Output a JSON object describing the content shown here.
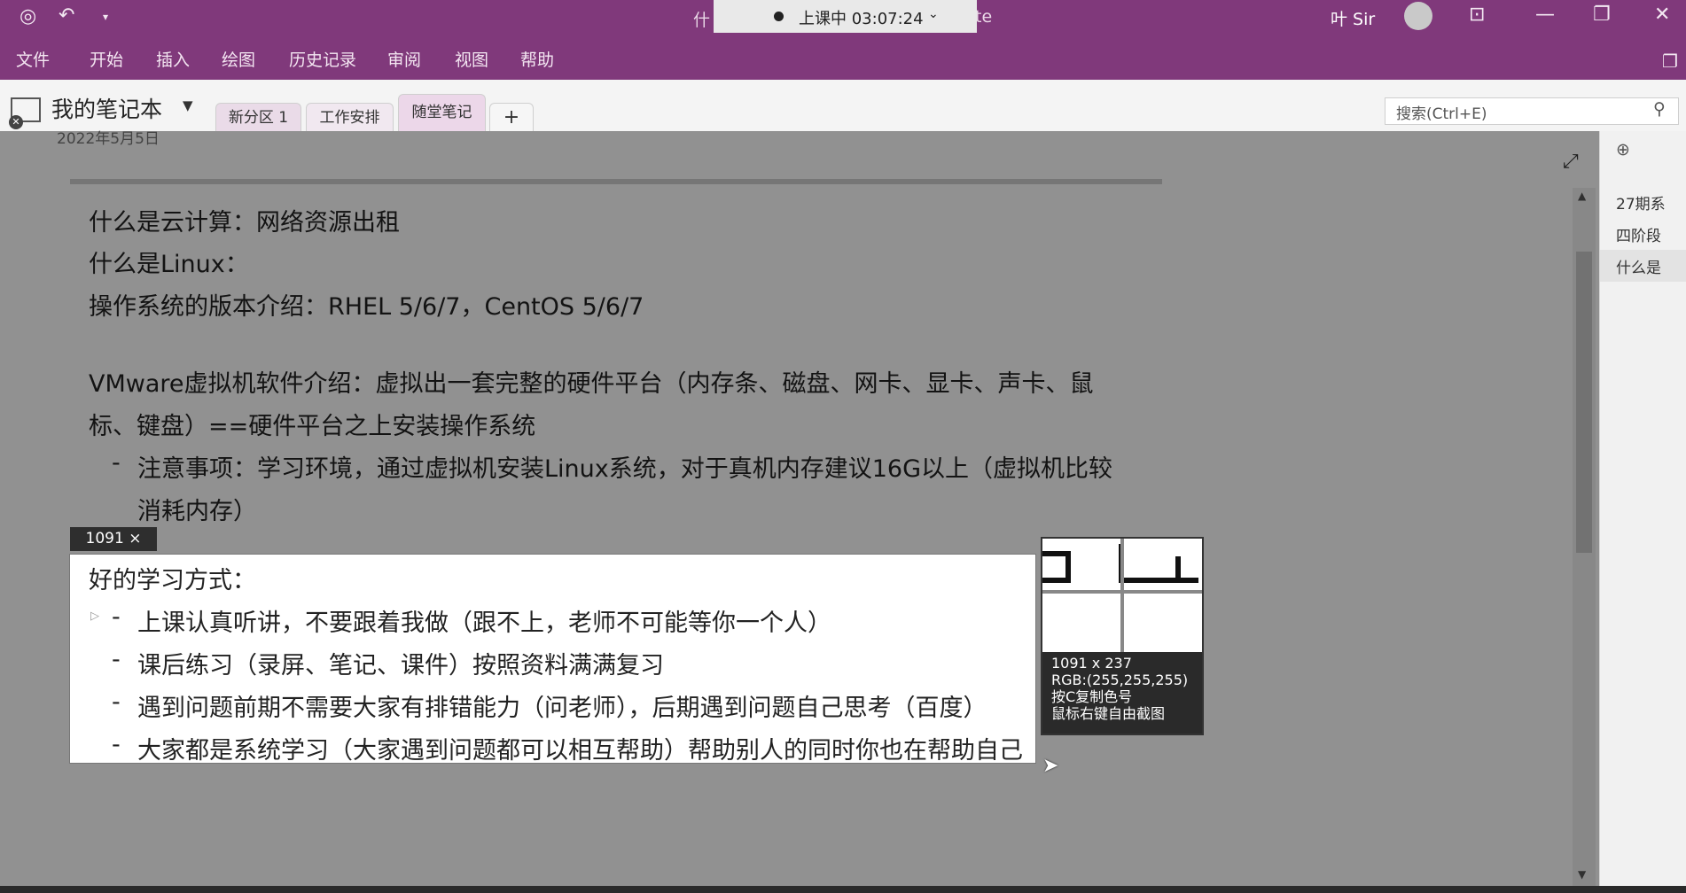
{
  "title_bar": {
    "title_left": "什",
    "title_right": "te",
    "recording": "上课中 03:07:24",
    "user": "叶 Sir"
  },
  "ribbon": {
    "tabs": [
      "文件",
      "开始",
      "插入",
      "绘图",
      "历史记录",
      "审阅",
      "视图",
      "帮助"
    ]
  },
  "notebook": {
    "name": "我的笔记本",
    "sections": [
      "新分区 1",
      "工作安排",
      "随堂笔记"
    ],
    "add_tab": "+",
    "search_placeholder": "搜索(Ctrl+E)"
  },
  "page": {
    "date_fragment": "2022年5月5日",
    "lines": [
      "什么是云计算：网络资源出租",
      "什么是Linux：",
      "操作系统的版本介绍：RHEL 5/6/7，CentOS 5/6/7",
      "VMware虚拟机软件介绍：虚拟出一套完整的硬件平台（内存条、磁盘、网卡、显卡、声卡、鼠",
      "标、键盘）==硬件平台之上安装操作系统"
    ],
    "note_bullet": {
      "line1": "注意事项：学习环境，通过虚拟机安装Linux系统，对于真机内存建议16G以上（虚拟机比较",
      "line2": "消耗内存）"
    },
    "study_heading": "好的学习方式：",
    "study_items": [
      "上课认真听讲，不要跟着我做（跟不上，老师不可能等你一个人）",
      "课后练习（录屏、笔记、课件）按照资料满满复习",
      "遇到问题前期不需要大家有排错能力（问老师），后期遇到问题自己思考（百度）",
      "大家都是系统学习（大家遇到问题都可以相互帮助）帮助别人的同时你也在帮助自己"
    ]
  },
  "right_pane": {
    "pages": [
      "27期系",
      "四阶段",
      "什么是"
    ]
  },
  "capture": {
    "dimension_badge": "1091 × 237",
    "info_lines": [
      "1091 x 237",
      "RGB:(255,255,255)",
      "按C复制色号",
      "鼠标右键自由截图"
    ]
  },
  "colors": {
    "accent": "#80397b"
  }
}
